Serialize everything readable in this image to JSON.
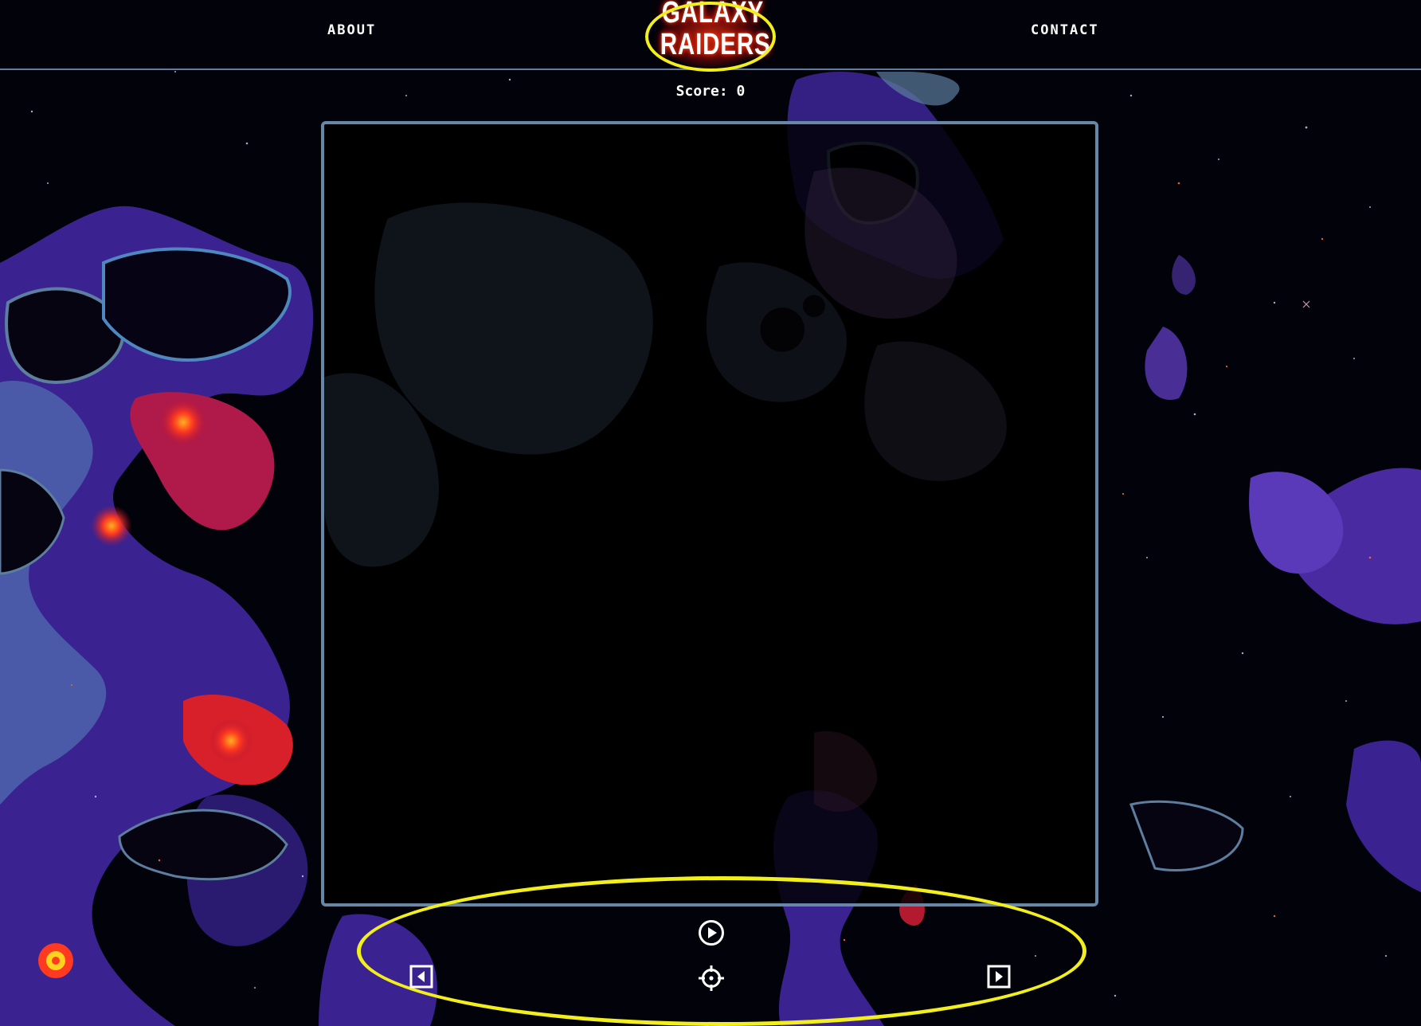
{
  "header": {
    "nav": {
      "about_label": "ABOUT",
      "contact_label": "CONTACT"
    },
    "logo": {
      "line1": "GALAXY",
      "line2": "RAIDERS"
    }
  },
  "game": {
    "score_text": "Score: 0"
  },
  "controls": {
    "play_icon": "play-circle-icon",
    "left_icon": "arrow-left-square-icon",
    "fire_icon": "crosshair-icon",
    "right_icon": "arrow-right-square-icon"
  },
  "colors": {
    "highlight": "#f2ef1c",
    "board_border": "#6787a6",
    "header_rule": "#5d7e9e",
    "nebula_purple": "#4a2aa0",
    "nebula_red": "#e0203a",
    "nebula_blue": "#4f88c0"
  }
}
